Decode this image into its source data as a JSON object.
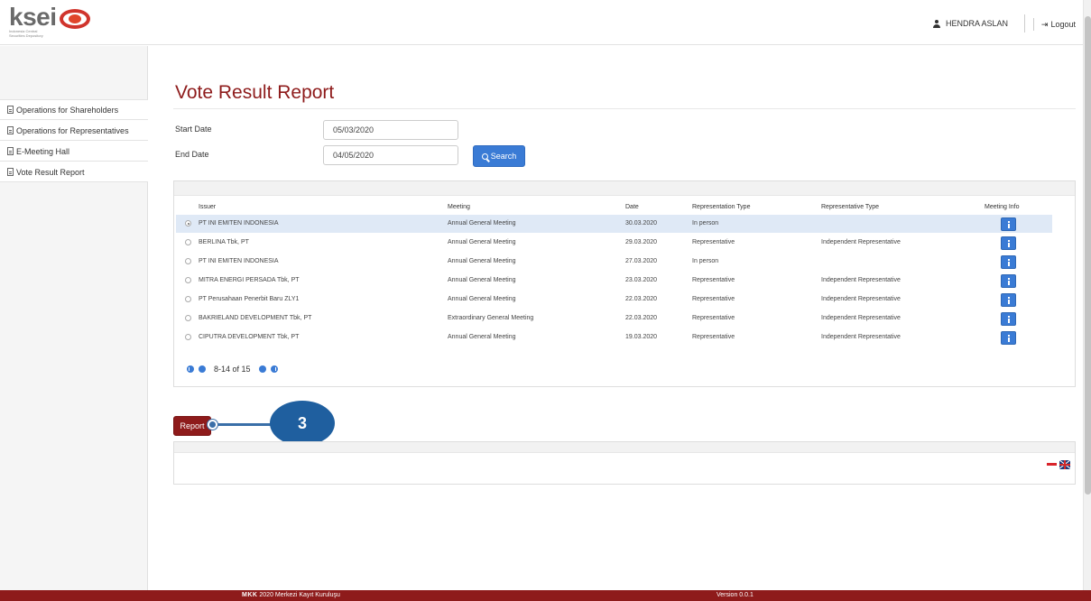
{
  "header": {
    "logo_text": "ksei",
    "logo_subtitle": "Indonesia Central Securities Depository",
    "user_name": "HENDRA ASLAN",
    "logout_label": "Logout"
  },
  "sidebar": {
    "items": [
      {
        "label": "Operations for Shareholders"
      },
      {
        "label": "Operations for Representatives"
      },
      {
        "label": "E-Meeting Hall"
      },
      {
        "label": "Vote Result Report"
      }
    ]
  },
  "page": {
    "title": "Vote Result Report",
    "start_date_label": "Start Date",
    "start_date_value": "05/03/2020",
    "end_date_label": "End Date",
    "end_date_value": "04/05/2020",
    "search_label": "Search",
    "report_label": "Report"
  },
  "grid": {
    "columns": [
      "Issuer",
      "Meeting",
      "Date",
      "Representation Type",
      "Representative Type",
      "Meeting Info"
    ],
    "rows": [
      {
        "issuer": "PT INI EMITEN INDONESIA",
        "meeting": "Annual General Meeting",
        "date": "30.03.2020",
        "rep_type": "In person",
        "representative": "",
        "selected": true
      },
      {
        "issuer": "BERLINA Tbk, PT",
        "meeting": "Annual General Meeting",
        "date": "29.03.2020",
        "rep_type": "Representative",
        "representative": "Independent Representative",
        "selected": false
      },
      {
        "issuer": "PT INI EMITEN INDONESIA",
        "meeting": "Annual General Meeting",
        "date": "27.03.2020",
        "rep_type": "In person",
        "representative": "",
        "selected": false
      },
      {
        "issuer": "MITRA ENERGI PERSADA Tbk, PT",
        "meeting": "Annual General Meeting",
        "date": "23.03.2020",
        "rep_type": "Representative",
        "representative": "Independent Representative",
        "selected": false
      },
      {
        "issuer": "PT Perusahaan Penerbit Baru ZLY1",
        "meeting": "Annual General Meeting",
        "date": "22.03.2020",
        "rep_type": "Representative",
        "representative": "Independent Representative",
        "selected": false
      },
      {
        "issuer": "BAKRIELAND DEVELOPMENT Tbk, PT",
        "meeting": "Extraordinary General Meeting",
        "date": "22.03.2020",
        "rep_type": "Representative",
        "representative": "Independent Representative",
        "selected": false
      },
      {
        "issuer": "CIPUTRA DEVELOPMENT Tbk, PT",
        "meeting": "Annual General Meeting",
        "date": "19.03.2020",
        "rep_type": "Representative",
        "representative": "Independent Representative",
        "selected": false
      }
    ],
    "pager_text": "8-14 of 15"
  },
  "callout": {
    "number": "3"
  },
  "footer": {
    "brand": "MKK",
    "copyright": " 2020 Merkezi Kayıt Kuruluşu",
    "version": "Version 0.0.1"
  },
  "colors": {
    "accent_red": "#8e1b1b",
    "button_blue": "#3a7bd5",
    "selected_row": "#dfe9f6",
    "callout_blue": "#1f5f9f"
  },
  "icons": [
    "user-icon",
    "logout-icon",
    "document-icon",
    "search-icon",
    "info-icon",
    "pager-first-icon",
    "pager-prev-icon",
    "pager-next-icon",
    "pager-last-icon",
    "flag-indonesia-icon",
    "flag-uk-icon"
  ]
}
